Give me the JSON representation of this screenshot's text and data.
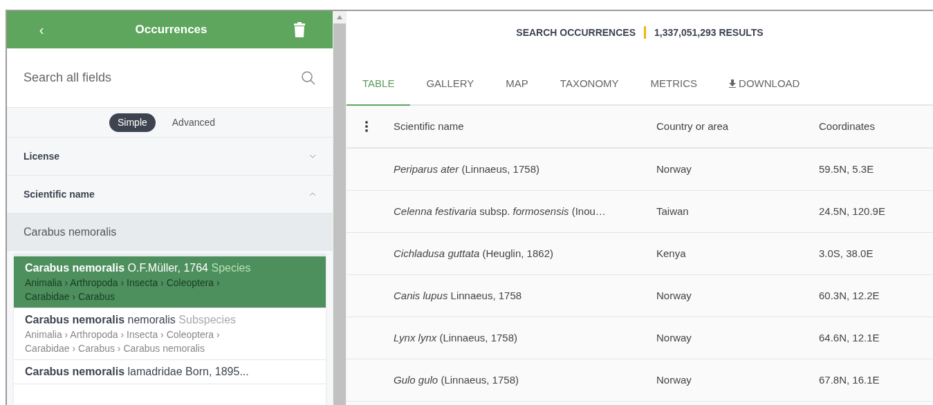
{
  "sidebar": {
    "back_icon": "‹",
    "title": "Occurrences",
    "search": {
      "placeholder": "Search all fields"
    },
    "modes": [
      {
        "label": "Simple",
        "selected": true
      },
      {
        "label": "Advanced",
        "selected": false
      }
    ],
    "filters": [
      {
        "label": "License",
        "expanded": false
      },
      {
        "label": "Scientific name",
        "expanded": true
      }
    ],
    "name_input": {
      "value": "Carabus nemoralis"
    },
    "suggestions": [
      {
        "title": "**Carabus nemoralis** O.F.Müller, 1764",
        "rank": "Species",
        "path": "Animalia › Arthropoda › Insecta › Coleoptera › Carabidae › Carabus",
        "selected": true
      },
      {
        "title": "**Carabus nemoralis** nemoralis",
        "rank": "Subspecies",
        "path": "Animalia › Arthropoda › Insecta › Coleoptera › Carabidae › Carabus › Carabus nemoralis",
        "selected": false
      },
      {
        "title": "**Carabus nemoralis** lamadridae Born, 1895...",
        "selected": false
      }
    ]
  },
  "main": {
    "heading": "SEARCH OCCURRENCES",
    "count": "1,337,051,293 RESULTS",
    "tabs": [
      {
        "label": "TABLE",
        "selected": true
      },
      {
        "label": "GALLERY",
        "selected": false
      },
      {
        "label": "MAP",
        "selected": false
      },
      {
        "label": "TAXONOMY",
        "selected": false
      },
      {
        "label": "METRICS",
        "selected": false
      },
      {
        "label": "DOWNLOAD",
        "kind": "download",
        "selected": false
      }
    ],
    "table": {
      "columns": [
        "Scientific name",
        "Country or area",
        "Coordinates"
      ],
      "rows": [
        [
          "*Periparus ater* (Linnaeus, 1758)",
          "Norway",
          "59.5N, 5.3E"
        ],
        [
          "*Celenna festivaria* subsp. *formosensis* (Inou…",
          "Taiwan",
          "24.5N, 120.9E"
        ],
        [
          "*Cichladusa guttata* (Heuglin, 1862)",
          "Kenya",
          "3.0S, 38.0E"
        ],
        [
          "*Canis lupus* Linnaeus, 1758",
          "Norway",
          "60.3N, 12.2E"
        ],
        [
          "*Lynx lynx* (Linnaeus, 1758)",
          "Norway",
          "64.6N, 12.1E"
        ],
        [
          "*Gulo gulo* (Linnaeus, 1758)",
          "Norway",
          "67.8N, 16.1E"
        ]
      ]
    }
  }
}
